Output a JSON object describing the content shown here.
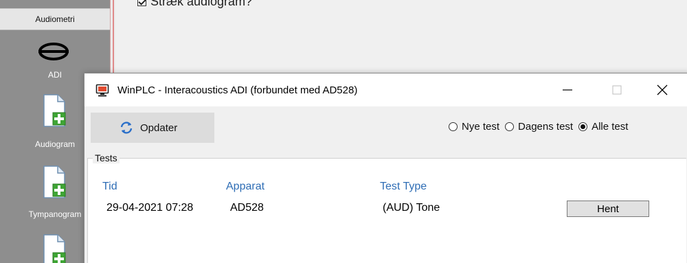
{
  "app": {
    "sidebar": {
      "header": "Audiometri",
      "items": [
        {
          "label": "ADI",
          "icon": "adi-logo-icon"
        },
        {
          "label": "Audiogram",
          "icon": "new-document-icon"
        },
        {
          "label": "Tympanogram",
          "icon": "new-document-icon"
        },
        {
          "label": "",
          "icon": "new-document-icon"
        }
      ]
    },
    "main": {
      "stretch_checkbox_label": "Stræk audiogram?"
    }
  },
  "dialog": {
    "title": "WinPLC - Interacoustics ADI (forbundet med AD528)",
    "refresh_label": "Opdater",
    "filters": [
      {
        "label": "Nye test",
        "selected": false
      },
      {
        "label": "Dagens test",
        "selected": false
      },
      {
        "label": "Alle test",
        "selected": true
      }
    ],
    "tests": {
      "legend": "Tests",
      "columns": [
        "Tid",
        "Apparat",
        "Test Type"
      ],
      "rows": [
        {
          "time": "29-04-2021 07:28",
          "device": "AD528",
          "type": "(AUD) Tone",
          "action": "Hent"
        }
      ]
    }
  },
  "colors": {
    "header_blue": "#2e6db5",
    "sidebar_gray": "#8e8e8e",
    "plus_green": "#3fa535"
  }
}
